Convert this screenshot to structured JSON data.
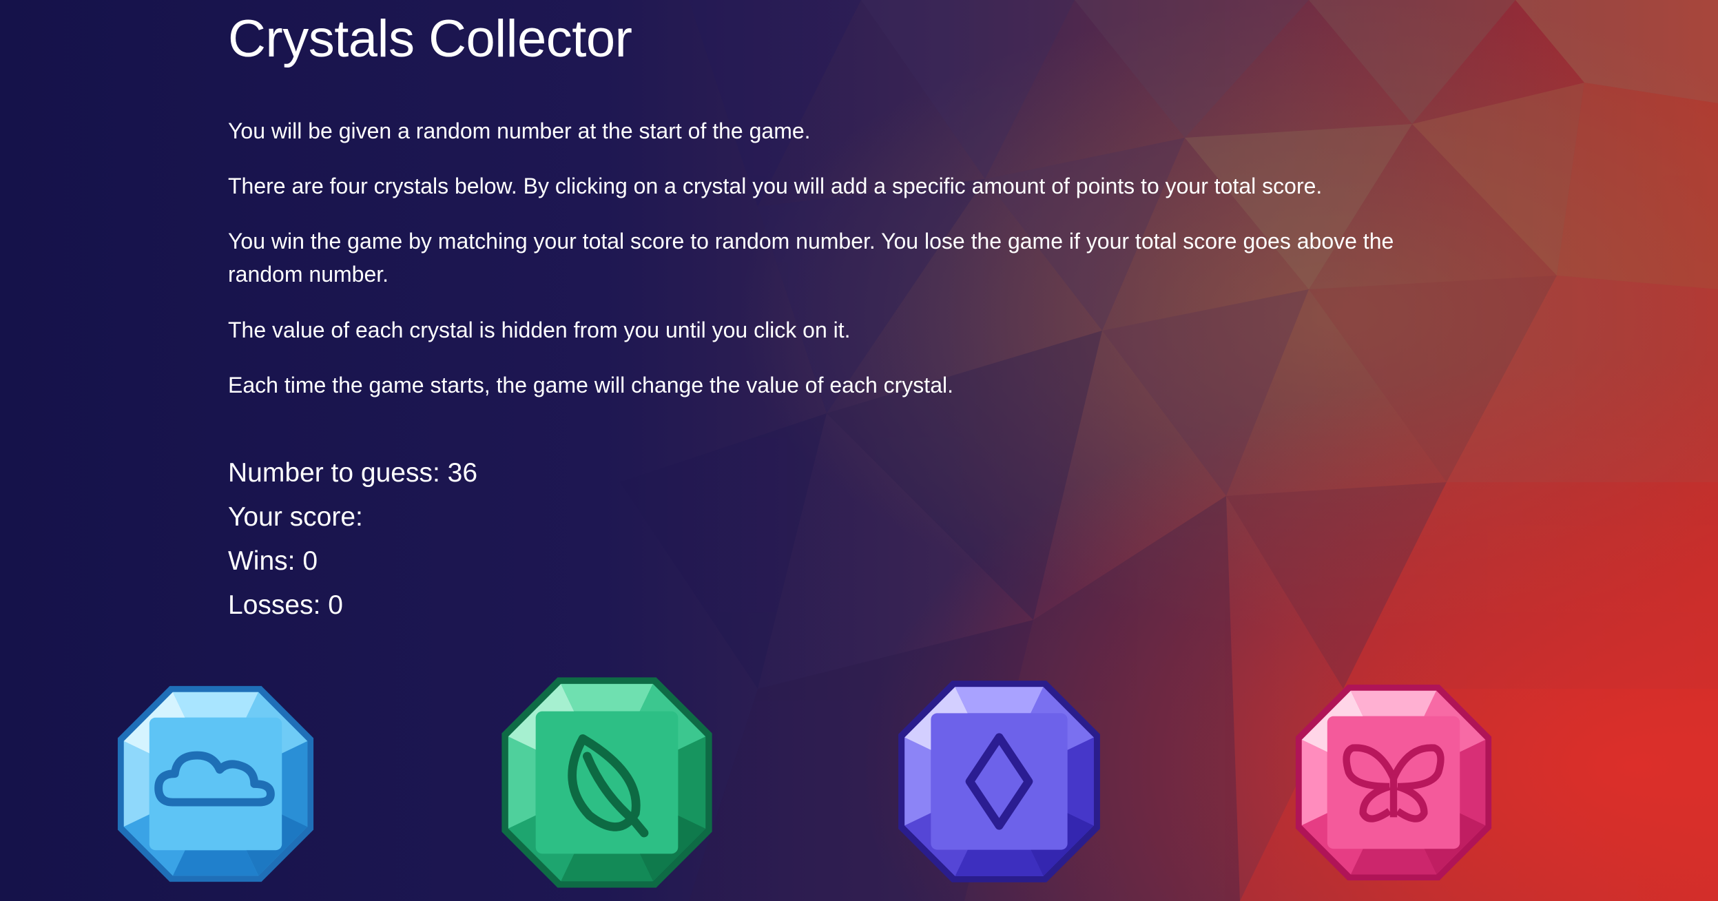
{
  "title": "Crystals Collector",
  "instructions": [
    "You will be given a random number at the start of the game.",
    "There are four crystals below. By clicking on a crystal you will add a specific amount of points to your total score.",
    "You win the game by matching your total score to random number. You lose the game if your total score goes above the random number.",
    "The value of each crystal is hidden from you until you click on it.",
    "Each time the game starts, the game will change the value of each crystal."
  ],
  "stats": {
    "number_to_guess": "Number to guess: 36",
    "your_score": "Your score:",
    "wins": "Wins: 0",
    "losses": "Losses: 0"
  },
  "crystals": [
    {
      "icon": "cloud-icon",
      "color": "#3fb3ee"
    },
    {
      "icon": "leaf-icon",
      "color": "#1fb57a"
    },
    {
      "icon": "diamond-icon",
      "color": "#5b4de0"
    },
    {
      "icon": "butterfly-icon",
      "color": "#f0468f"
    }
  ],
  "colors": {
    "background_dark": "#17134a",
    "background_red": "#c42a2a",
    "text": "#ffffff"
  }
}
